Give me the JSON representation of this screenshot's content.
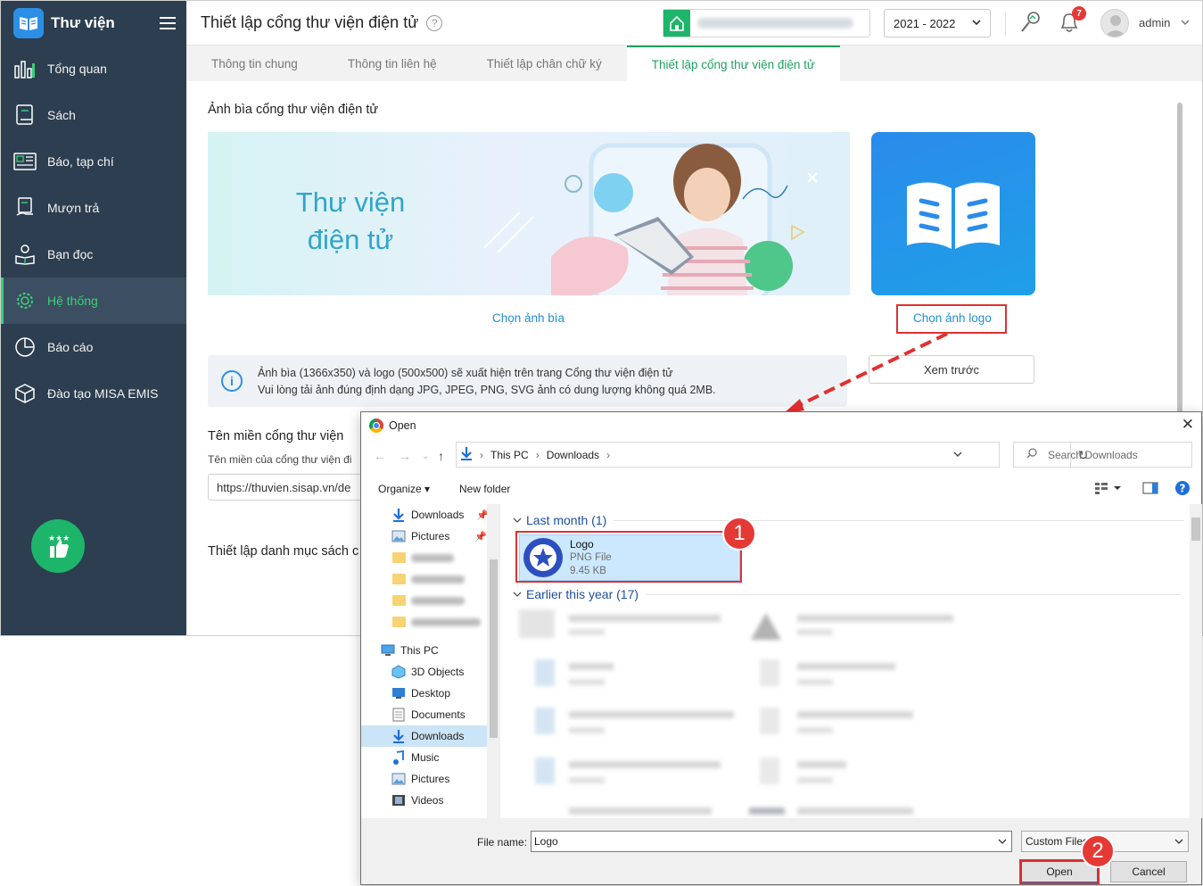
{
  "sidebar": {
    "brand": "Thư viện",
    "items": [
      {
        "label": "Tổng quan",
        "icon": "bar-chart-icon"
      },
      {
        "label": "Sách",
        "icon": "book-icon"
      },
      {
        "label": "Báo, tạp chí",
        "icon": "newspaper-icon"
      },
      {
        "label": "Mượn trả",
        "icon": "borrow-icon"
      },
      {
        "label": "Bạn đọc",
        "icon": "reader-icon"
      },
      {
        "label": "Hệ thống",
        "icon": "gear-icon",
        "active": true
      },
      {
        "label": "Báo cáo",
        "icon": "report-icon"
      },
      {
        "label": "Đào tạo MISA EMIS",
        "icon": "cube-icon"
      }
    ]
  },
  "header": {
    "title": "Thiết lập cổng thư viện điện tử",
    "year": "2021 - 2022",
    "notification_count": "7",
    "user": "admin"
  },
  "tabs": [
    {
      "label": "Thông tin chung"
    },
    {
      "label": "Thông tin liên hệ"
    },
    {
      "label": "Thiết lập chân chữ ký"
    },
    {
      "label": "Thiết lập cổng thư viện điện tử",
      "active": true
    }
  ],
  "content": {
    "cover_section_title": "Ảnh bìa cổng thư viện điện tử",
    "cover_text_line1": "Thư viện",
    "cover_text_line2": "điện tử",
    "choose_cover": "Chọn ảnh bìa",
    "choose_logo": "Chọn ảnh logo",
    "preview": "Xem trước",
    "info_line1": "Ảnh bìa (1366x350) và logo (500x500) sẽ xuất hiện trên trang Cổng thư viện điện tử",
    "info_line2": "Vui lòng tải ảnh đúng định dạng JPG, JPEG, PNG, SVG ảnh có dung lượng không quá 2MB.",
    "domain_title": "Tên miền cổng thư viện",
    "domain_sub": "Tên miền của cổng thư viện đi",
    "domain_value": "https://thuvien.sisap.vn/de",
    "catalog_title": "Thiết lập danh mục sách c"
  },
  "dialog": {
    "title": "Open",
    "breadcrumb": [
      "This PC",
      "Downloads"
    ],
    "search_placeholder": "Search Downloads",
    "organize": "Organize",
    "new_folder": "New folder",
    "left_pane": {
      "quick": [
        {
          "label": "Downloads",
          "icon": "download-arrow-icon"
        },
        {
          "label": "Pictures",
          "icon": "pictures-icon"
        }
      ],
      "this_pc": "This PC",
      "pc_items": [
        {
          "label": "3D Objects",
          "icon": "3d-objects-icon"
        },
        {
          "label": "Desktop",
          "icon": "desktop-icon"
        },
        {
          "label": "Documents",
          "icon": "documents-icon"
        },
        {
          "label": "Downloads",
          "icon": "download-arrow-icon",
          "selected": true
        },
        {
          "label": "Music",
          "icon": "music-icon"
        },
        {
          "label": "Pictures",
          "icon": "pictures-icon"
        },
        {
          "label": "Videos",
          "icon": "videos-icon"
        }
      ]
    },
    "group1": "Last month (1)",
    "group2": "Earlier this year (17)",
    "file": {
      "name": "Logo",
      "type": "PNG File",
      "size": "9.45 KB"
    },
    "file_name_label": "File name:",
    "file_name_value": "Logo",
    "file_type": "Custom Files",
    "open": "Open",
    "cancel": "Cancel"
  },
  "annotations": {
    "step1": "1",
    "step2": "2"
  },
  "colors": {
    "sidebar": "#2d3e50",
    "accent_green": "#1ea160",
    "link_blue": "#1f8fd6",
    "highlight_red": "#e03030"
  }
}
